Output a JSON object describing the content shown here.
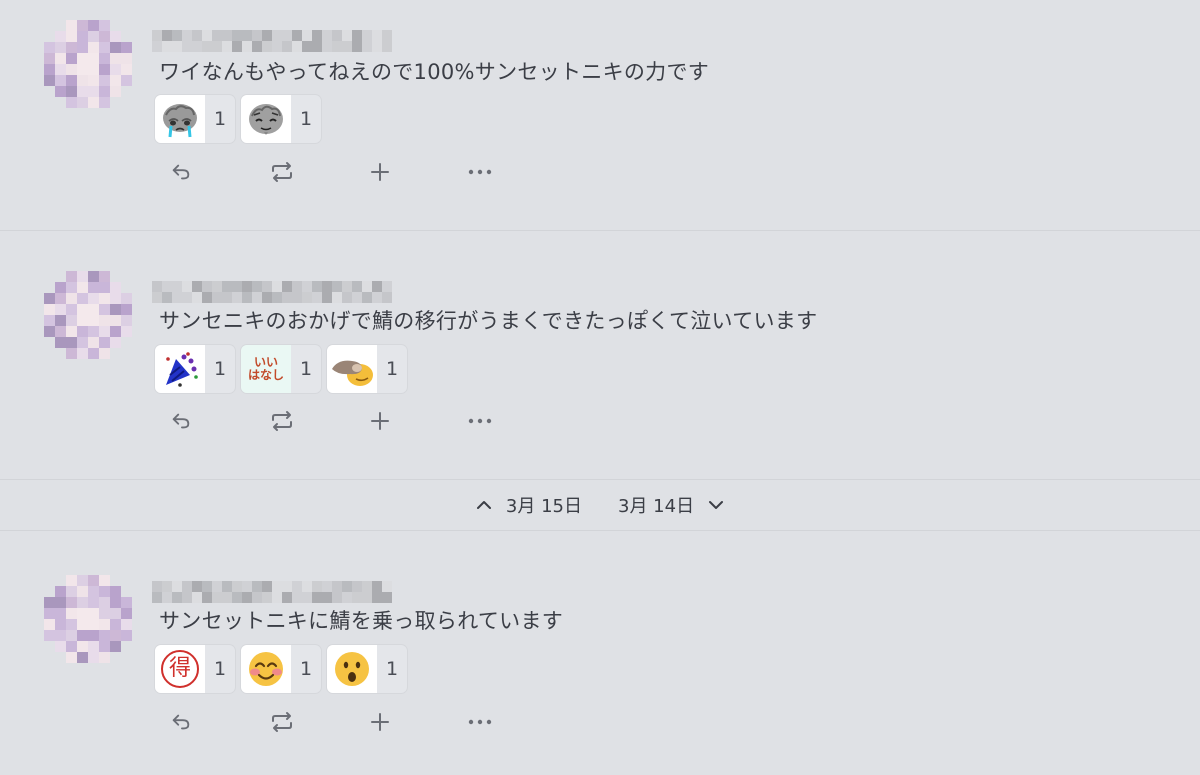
{
  "notes": [
    {
      "text": "ワイなんもやってねえので100%サンセットニキの力です",
      "reactions": [
        {
          "emoji": "crying-brain-emoji",
          "count": "1"
        },
        {
          "emoji": "relieved-brain-emoji",
          "count": "1"
        }
      ]
    },
    {
      "text": "サンセニキのおかげで鯖の移行がうまくできたっぽくて泣いています",
      "reactions": [
        {
          "emoji": "party-popper-emoji",
          "count": "1"
        },
        {
          "emoji": "ii-hanashi-emoji",
          "count": "1"
        },
        {
          "emoji": "pinching-emoji",
          "count": "1"
        }
      ]
    },
    {
      "text": "サンセットニキに鯖を乗っ取られています",
      "reactions": [
        {
          "emoji": "toku-stamp-emoji",
          "count": "1"
        },
        {
          "emoji": "blushing-smile-emoji",
          "count": "1"
        },
        {
          "emoji": "surprised-face-emoji",
          "count": "1"
        }
      ]
    }
  ],
  "date_separator": {
    "newer_date": "3月 15日",
    "older_date": "3月 14日"
  },
  "emoji_text": {
    "ii_hanashi_line1": "いい",
    "ii_hanashi_line2": "はなし",
    "toku": "得"
  },
  "icons": {
    "reply": "reply-icon",
    "renote": "renote-icon",
    "react": "plus-icon",
    "more": "more-icon",
    "newer": "chevron-up-icon",
    "older": "chevron-down-icon"
  },
  "colors": {
    "background": "#dfe1e5",
    "text": "#3b3e46",
    "icon": "#6b6e76",
    "toku_red": "#d0302c",
    "face_yellow": "#f6c343"
  }
}
